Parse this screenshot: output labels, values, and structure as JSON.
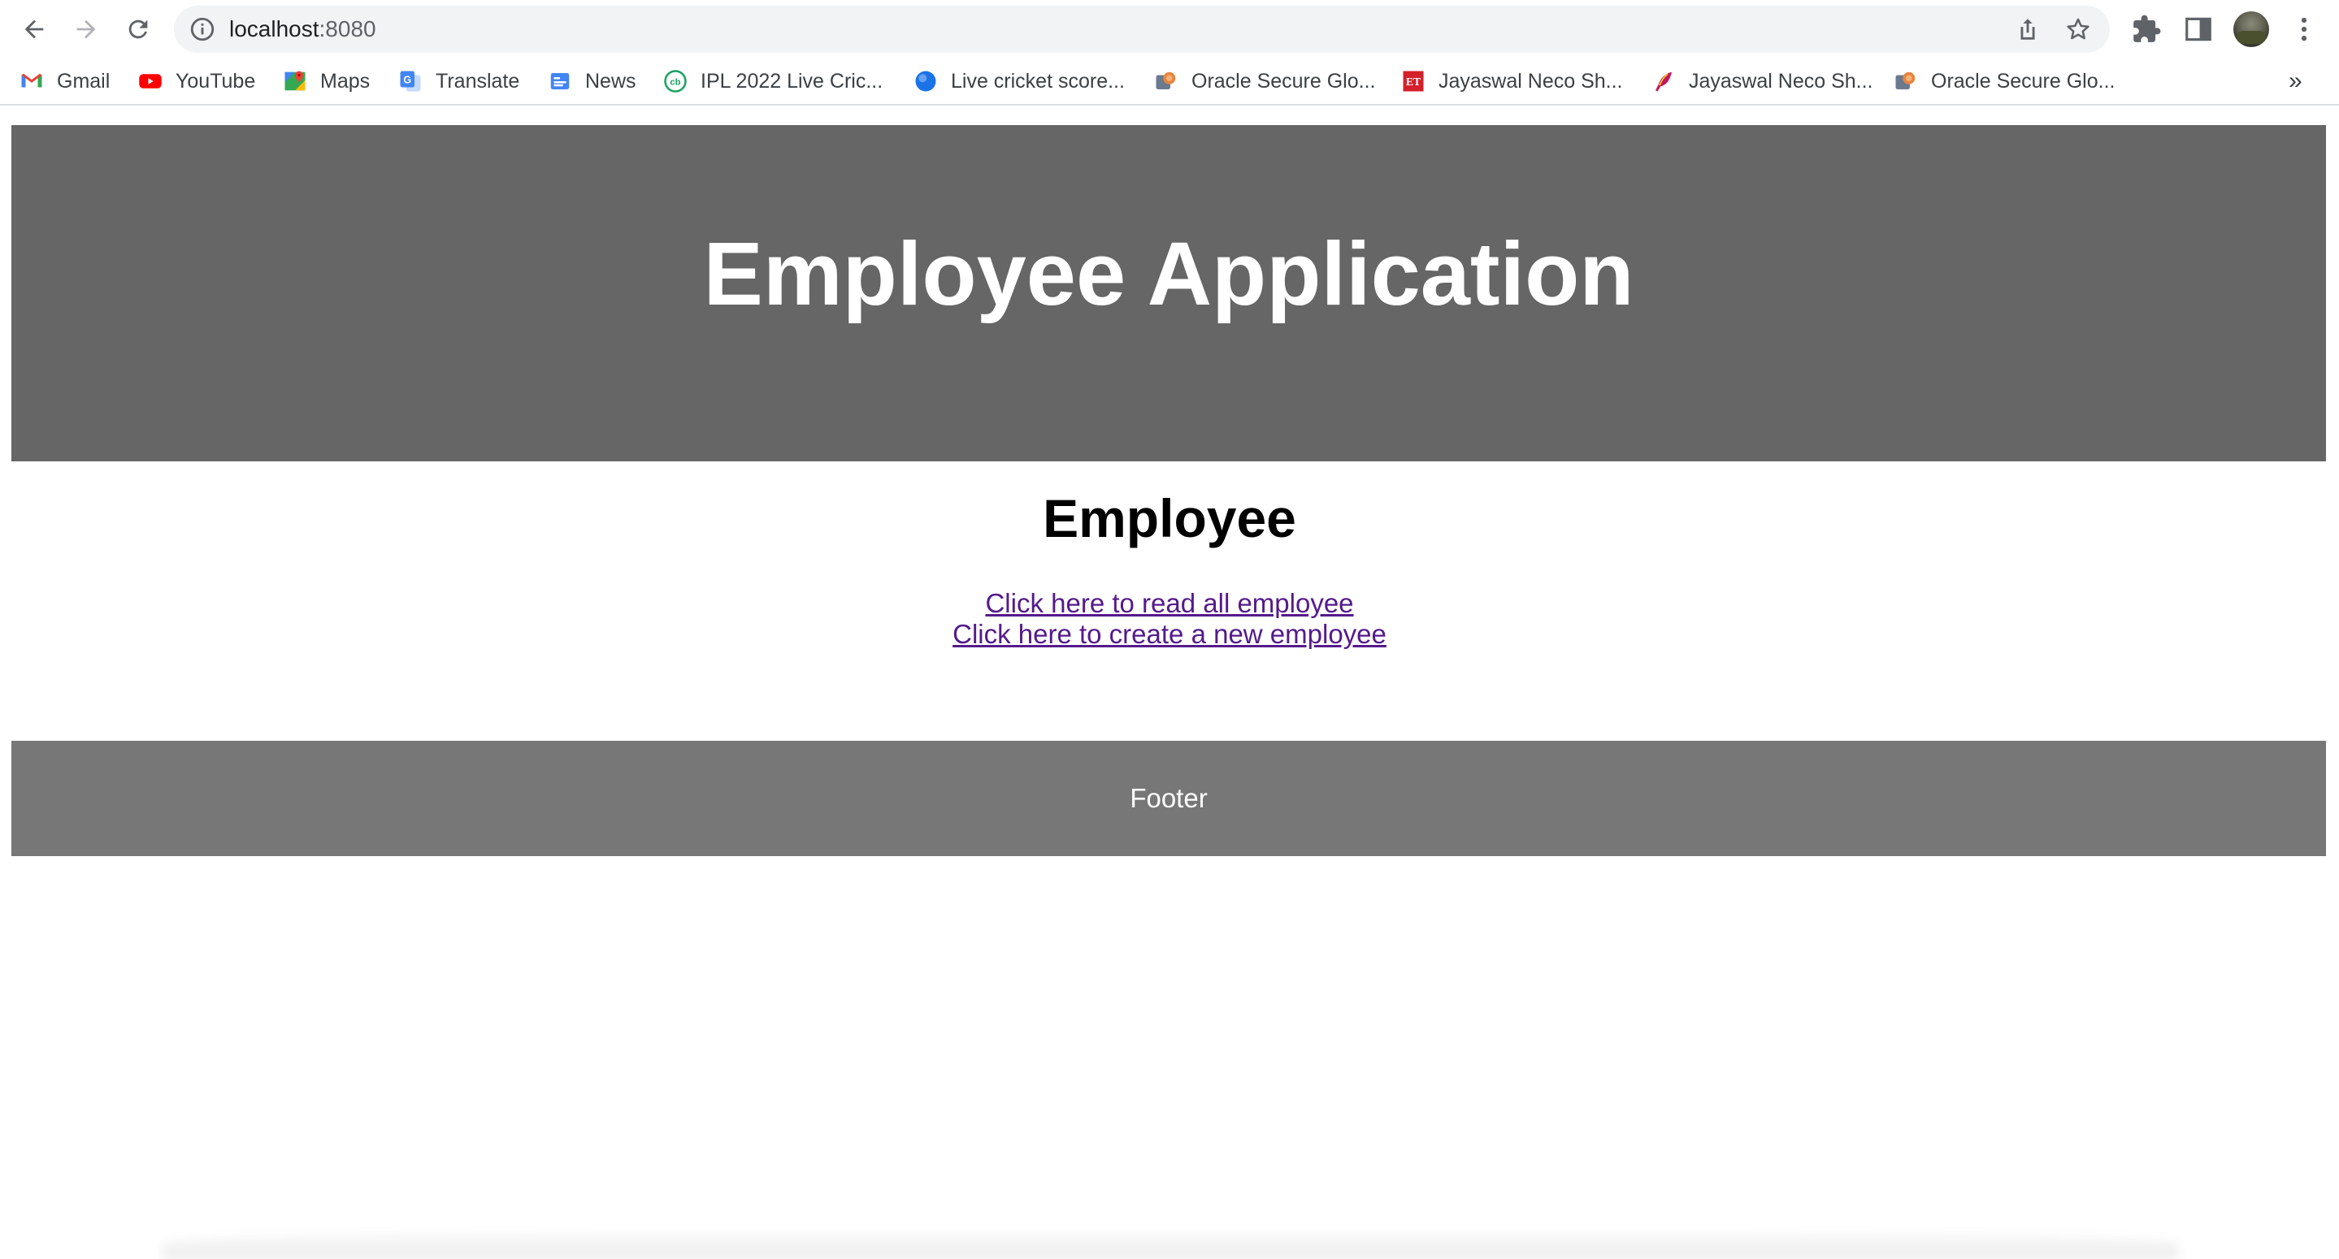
{
  "browser": {
    "url_host": "localhost",
    "url_port": ":8080",
    "bookmarks": [
      {
        "label": "Gmail",
        "icon": "gmail-icon"
      },
      {
        "label": "YouTube",
        "icon": "youtube-icon"
      },
      {
        "label": "Maps",
        "icon": "maps-icon"
      },
      {
        "label": "Translate",
        "icon": "translate-icon"
      },
      {
        "label": "News",
        "icon": "news-icon"
      },
      {
        "label": "IPL 2022 Live Cric...",
        "icon": "cricbuzz-icon"
      },
      {
        "label": "Live cricket score...",
        "icon": "globe-icon"
      },
      {
        "label": "Oracle Secure Glo...",
        "icon": "oracle-icon"
      },
      {
        "label": "Jayaswal Neco Sh...",
        "icon": "et-icon"
      },
      {
        "label": "Jayaswal Neco Sh...",
        "icon": "feather-icon"
      },
      {
        "label": "Oracle Secure Glo...",
        "icon": "oracle-icon"
      }
    ],
    "more_label": "»"
  },
  "page": {
    "header_title": "Employee Application",
    "section_title": "Employee",
    "links": {
      "read_all": "Click here to read all employee",
      "create_new": "Click here to create a new employee"
    },
    "footer": "Footer"
  },
  "colors": {
    "header_bg": "#666666",
    "footer_bg": "#777777",
    "link": "#551a8b"
  }
}
